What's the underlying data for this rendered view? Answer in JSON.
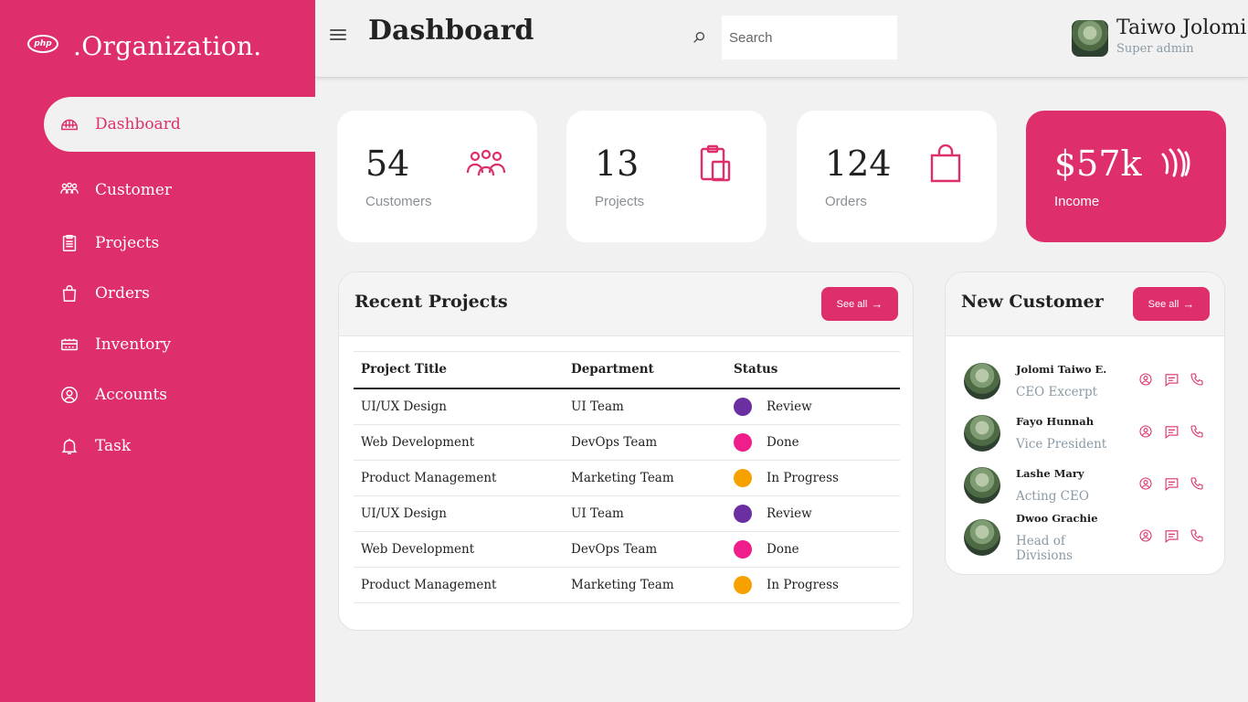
{
  "brand": {
    "logo_text": "php",
    "name": ".Organization."
  },
  "sidebar": {
    "items": [
      {
        "label": "Dashboard",
        "icon": "dashboard-icon",
        "active": true
      },
      {
        "label": "Customer",
        "icon": "users-icon"
      },
      {
        "label": "Projects",
        "icon": "clipboard-icon"
      },
      {
        "label": "Orders",
        "icon": "shopping-bag-icon"
      },
      {
        "label": "Inventory",
        "icon": "inventory-icon"
      },
      {
        "label": "Accounts",
        "icon": "user-circle-icon"
      },
      {
        "label": "Task",
        "icon": "bell-icon"
      }
    ]
  },
  "header": {
    "title": "Dashboard",
    "search_placeholder": "Search",
    "user": {
      "name": "Taiwo Jolomi",
      "role": "Super admin"
    }
  },
  "stats": [
    {
      "value": "54",
      "label": "Customers",
      "icon": "users-icon"
    },
    {
      "value": "13",
      "label": "Projects",
      "icon": "clipboard-icon"
    },
    {
      "value": "124",
      "label": "Orders",
      "icon": "shopping-bag-icon"
    },
    {
      "value": "$57k",
      "label": "Income",
      "icon": "income-icon"
    }
  ],
  "recent_projects": {
    "title": "Recent Projects",
    "see_all": "See all",
    "columns": [
      "Project Title",
      "Department",
      "Status"
    ],
    "rows": [
      {
        "title": "UI/UX Design",
        "department": "UI Team",
        "status": "Review",
        "color": "#6b2fa1"
      },
      {
        "title": "Web Development",
        "department": "DevOps Team",
        "status": "Done",
        "color": "#f01e8a"
      },
      {
        "title": "Product Management",
        "department": "Marketing Team",
        "status": "In Progress",
        "color": "#f7a100"
      },
      {
        "title": "UI/UX Design",
        "department": "UI Team",
        "status": "Review",
        "color": "#6b2fa1"
      },
      {
        "title": "Web Development",
        "department": "DevOps Team",
        "status": "Done",
        "color": "#f01e8a"
      },
      {
        "title": "Product Management",
        "department": "Marketing Team",
        "status": "In Progress",
        "color": "#f7a100"
      }
    ]
  },
  "new_customer": {
    "title": "New Customer",
    "see_all": "See all",
    "customers": [
      {
        "name": "Jolomi Taiwo E.",
        "role": "CEO Excerpt"
      },
      {
        "name": "Fayo Hunnah",
        "role": "Vice President"
      },
      {
        "name": "Lashe Mary",
        "role": "Acting CEO"
      },
      {
        "name": "Dwoo Grachie",
        "role": "Head of Divisions"
      }
    ]
  },
  "colors": {
    "accent": "#de2f6c",
    "background": "#f1f1f1"
  }
}
